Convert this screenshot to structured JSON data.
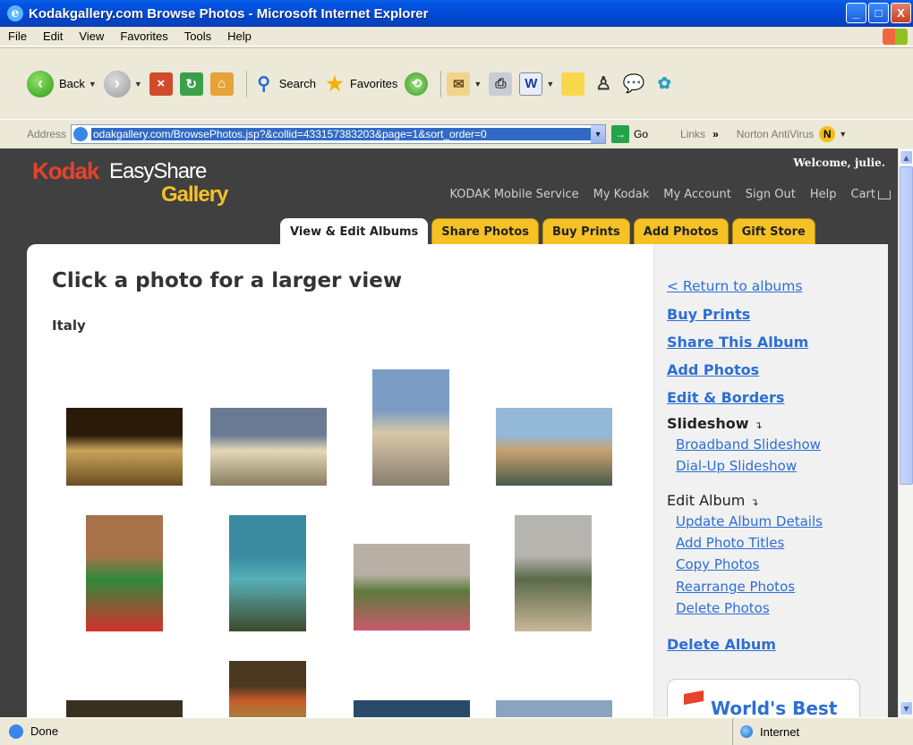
{
  "window": {
    "title": "Kodakgallery.com  Browse Photos - Microsoft Internet Explorer",
    "controls": [
      "_",
      "□",
      "X"
    ]
  },
  "menu": [
    "File",
    "Edit",
    "View",
    "Favorites",
    "Tools",
    "Help"
  ],
  "toolbar": {
    "back_label": "Back",
    "search_label": "Search",
    "favorites_label": "Favorites"
  },
  "address": {
    "label": "Address",
    "url": "odakgallery.com/BrowsePhotos.jsp?&collid=433157383203&page=1&sort_order=0",
    "go_label": "Go",
    "links_label": "Links",
    "chevron": "»",
    "norton_label": "Norton AntiVirus"
  },
  "site": {
    "logo_kodak": "Kodak",
    "logo_easyshare": "EasyShare",
    "logo_gallery": "Gallery",
    "welcome": "Welcome, julie.",
    "nav": [
      "KODAK Mobile Service",
      "My Kodak",
      "My Account",
      "Sign Out",
      "Help",
      "Cart"
    ],
    "tabs": [
      "View & Edit Albums",
      "Share Photos",
      "Buy Prints",
      "Add Photos",
      "Gift Store"
    ],
    "active_tab": "View & Edit Albums"
  },
  "main": {
    "heading": "Click a photo for a larger view",
    "album_name": "Italy",
    "photos": [
      {
        "name": "photo-vittoriano-night",
        "colors": [
          "#2a1a08",
          "#c9a55a",
          "#6b4d22"
        ]
      },
      {
        "name": "photo-colonnade-sky",
        "colors": [
          "#6a7a95",
          "#e4d8b8",
          "#8a7e62"
        ]
      },
      {
        "name": "photo-st-peters-square",
        "colors": [
          "#7a9cc4",
          "#d8c8a6",
          "#8a7f70"
        ]
      },
      {
        "name": "photo-castel-santangelo",
        "colors": [
          "#94b8d8",
          "#c7a171",
          "#4a5a4a"
        ]
      },
      {
        "name": "photo-italian-flag",
        "colors": [
          "#a9734a",
          "#2e8a3c",
          "#d5312b"
        ]
      },
      {
        "name": "photo-coastal-cliffs",
        "colors": [
          "#3a8aa0",
          "#57b0b8",
          "#3d4a2a"
        ]
      },
      {
        "name": "photo-cafe-street",
        "colors": [
          "#b8b0a4",
          "#5e7a3c",
          "#c95a6a"
        ]
      },
      {
        "name": "photo-positano-hillside",
        "colors": [
          "#b6b4ae",
          "#5a6a4a",
          "#c9b698"
        ]
      },
      {
        "name": "photo-market-produce",
        "colors": [
          "#4a3820",
          "#c95a2a",
          "#8aa04a"
        ]
      },
      {
        "name": "photo-row4-a",
        "colors": [
          "#3a3020",
          "#7a6a40",
          "#2a2418"
        ]
      },
      {
        "name": "photo-row4-b",
        "colors": [
          "#2a4a6a",
          "#5a7aa0",
          "#3a5a80"
        ]
      },
      {
        "name": "photo-row4-c",
        "colors": [
          "#8aa4c0",
          "#b8c4d0",
          "#7a8a9a"
        ]
      }
    ]
  },
  "sidebar": {
    "return_link": "< Return to albums",
    "buy_prints": "Buy Prints",
    "share_album": "Share This Album",
    "add_photos": "Add Photos",
    "edit_borders": "Edit & Borders",
    "slideshow_head": "Slideshow",
    "broadband": "Broadband Slideshow",
    "dialup": "Dial-Up Slideshow",
    "edit_album_head": "Edit Album",
    "update_details": "Update Album Details",
    "add_titles": "Add Photo Titles",
    "copy_photos": "Copy Photos",
    "rearrange": "Rearrange Photos",
    "delete_photos": "Delete Photos",
    "delete_album": "Delete Album",
    "promo_text": "World's Best"
  },
  "status": {
    "text": "Done",
    "zone": "Internet"
  }
}
